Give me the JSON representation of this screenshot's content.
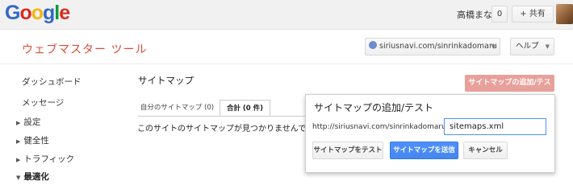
{
  "top": {
    "logo": {
      "l1": "G",
      "l2": "o",
      "l3": "o",
      "l4": "g",
      "l5": "l",
      "l6": "e"
    },
    "username": "高橋まな",
    "notifications": "0",
    "share": "+ 共有"
  },
  "header": {
    "app_title": "ウェブマスター ツール",
    "site": "siriusnavi.com/sinrinkadomaru",
    "help": "ヘルプ"
  },
  "sidebar": {
    "items": [
      {
        "label": "ダッシュボード"
      },
      {
        "label": "メッセージ"
      },
      {
        "label": "設定"
      },
      {
        "label": "健全性"
      },
      {
        "label": "トラフィック"
      },
      {
        "label": "最適化"
      }
    ]
  },
  "main": {
    "title": "サイトマップ",
    "add_button": "サイトマップの追加/テスト",
    "tabs": [
      {
        "label": "自分のサイトマップ (0)"
      },
      {
        "label": "合計 (0 件)"
      }
    ],
    "empty_message": "このサイトのサイトマップが見つかりませんでした。"
  },
  "dialog": {
    "title": "サイトマップの追加/テスト",
    "url_prefix": "http://siriusnavi.com/sinrinkadomaru/",
    "input_value": "sitemaps.xml",
    "test_button": "サイトマップをテスト",
    "submit_button": "サイトマップを送信",
    "cancel_button": "キャンセル"
  },
  "colors": {
    "accent_red": "#dd4b39",
    "submit_blue": "#4d90fe",
    "add_button_bg": "#e8a09a"
  }
}
